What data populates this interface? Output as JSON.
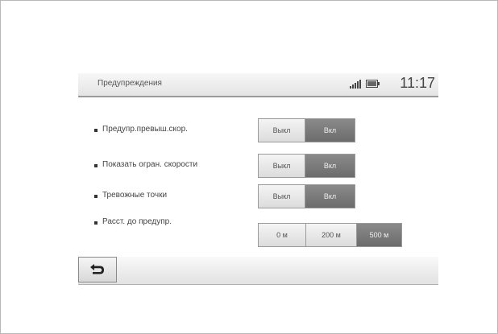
{
  "header": {
    "title": "Предупреждения",
    "time": "11:17",
    "status_icons": [
      "signal-icon",
      "battery-icon"
    ]
  },
  "settings": [
    {
      "label": "Предупр.превыш.скор.",
      "options": [
        {
          "label": "Выкл",
          "selected": false
        },
        {
          "label": "Вкл",
          "selected": true
        }
      ]
    },
    {
      "label": "Показать огран. скорости",
      "options": [
        {
          "label": "Выкл",
          "selected": false
        },
        {
          "label": "Вкл",
          "selected": true
        }
      ]
    },
    {
      "label": "Тревожные точки",
      "options": [
        {
          "label": "Выкл",
          "selected": false
        },
        {
          "label": "Вкл",
          "selected": true
        }
      ]
    },
    {
      "label": "Расст. до предупр.",
      "options": [
        {
          "label": "0 м",
          "selected": false
        },
        {
          "label": "200 м",
          "selected": false
        },
        {
          "label": "500 м",
          "selected": true
        }
      ]
    }
  ],
  "footer": {
    "back_icon": "back-arrow-icon"
  },
  "colors": {
    "selected": "#7a7a7a",
    "unselected": "#e8e8e8"
  }
}
